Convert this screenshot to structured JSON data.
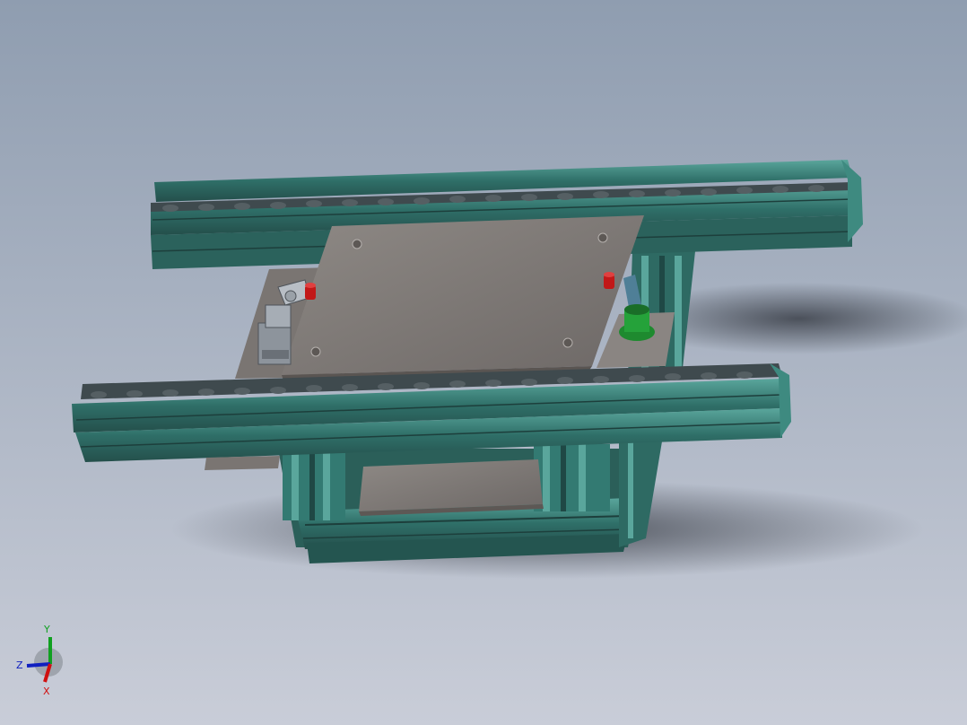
{
  "viewport": {
    "background_top": "#8f9db0",
    "background_bottom": "#c8ccd8",
    "frame_color": "#2f6f68",
    "frame_light": "#4a9a90",
    "plate_color": "#7f7a78",
    "plate_light": "#9a9591",
    "roller_color": "#3f4a4e"
  },
  "triad": {
    "x_label": "X",
    "y_label": "Y",
    "z_label": "Z",
    "x_color": "#d01010",
    "y_color": "#10a020",
    "z_color": "#1020c0"
  }
}
